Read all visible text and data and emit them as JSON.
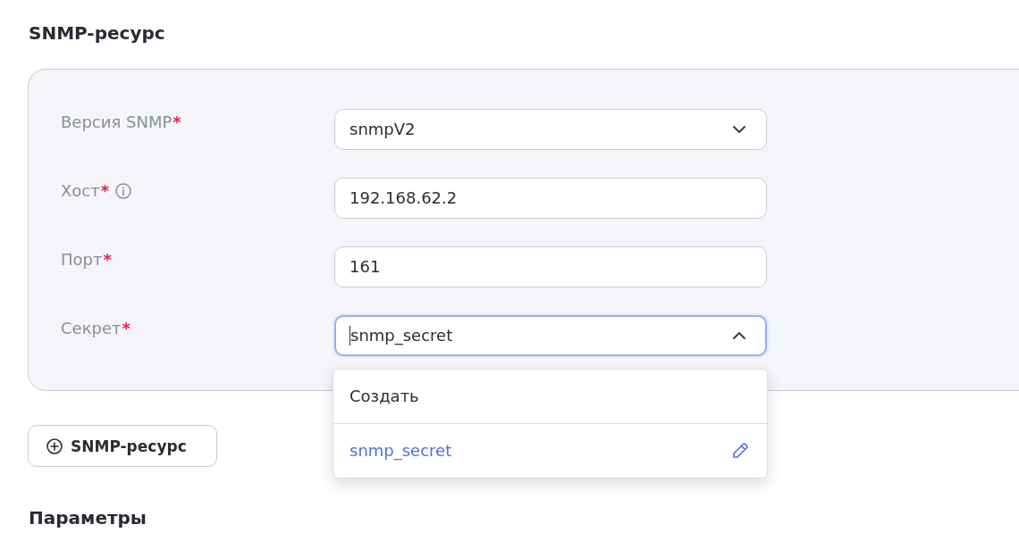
{
  "section_title": "SNMP-ресурс",
  "form": {
    "fields": [
      {
        "label": "Версия SNMP",
        "required_mark": "*",
        "info": false,
        "kind": "select",
        "value": "snmpV2",
        "focused": false,
        "expanded": false
      },
      {
        "label": "Хост",
        "required_mark": "*",
        "info": true,
        "kind": "text",
        "value": "192.168.62.2",
        "focused": false
      },
      {
        "label": "Порт",
        "required_mark": "*",
        "info": false,
        "kind": "text",
        "value": "161",
        "focused": false
      },
      {
        "label": "Секрет",
        "required_mark": "*",
        "info": false,
        "kind": "select",
        "value": "snmp_secret",
        "focused": true,
        "expanded": true,
        "options": [
          {
            "label": "Создать",
            "selected": false,
            "editable": false
          },
          {
            "label": "snmp_secret",
            "selected": true,
            "editable": true
          }
        ]
      }
    ]
  },
  "add_button": {
    "label": "SNMP-ресурс"
  },
  "next_section_title": "Параметры"
}
